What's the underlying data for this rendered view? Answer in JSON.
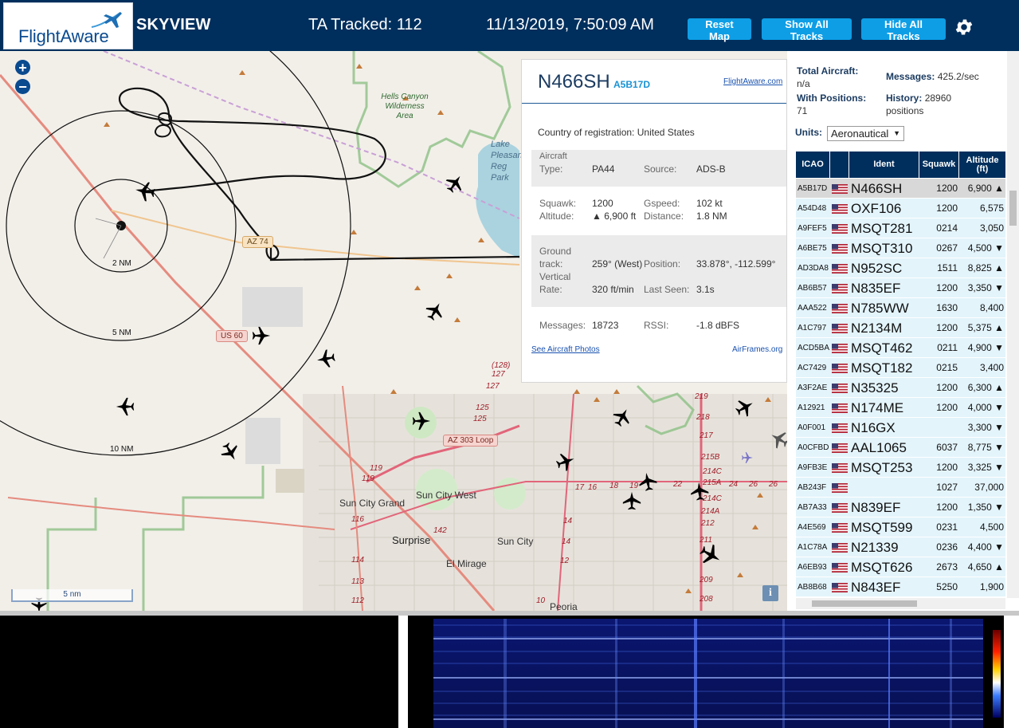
{
  "header": {
    "logo_text": "FlightAware",
    "app_name": "SKYVIEW",
    "ta_tracked": "TA Tracked: 112",
    "clock": "11/13/2019, 7:50:09 AM",
    "buttons": {
      "reset": "Reset Map",
      "show_all": "Show All Tracks",
      "hide_all": "Hide All Tracks"
    },
    "settings_icon": "gear-icon",
    "colors": {
      "bar": "#002f5d",
      "button": "#0e9ee6"
    }
  },
  "map": {
    "zoom_in": "+",
    "zoom_out": "−",
    "scale_label": "5 nm",
    "info_label": "i",
    "range_rings": [
      "2 NM",
      "5 NM",
      "10 NM"
    ],
    "places": [
      "Hells Canyon Wilderness Area",
      "Sun City Grand",
      "Sun City West",
      "Surprise",
      "Sun City",
      "El Mirage",
      "Peoria"
    ],
    "water": [
      "Lake Pleasant Reg Park"
    ],
    "shields": [
      "AZ 74",
      "US 60",
      "AZ 303 Loop"
    ],
    "road_numbers": [
      "(128)",
      "127",
      "127",
      "125",
      "125",
      "119",
      "119",
      "116",
      "114",
      "113",
      "112",
      "142",
      "14",
      "14",
      "12",
      "10",
      "17",
      "16",
      "18",
      "19",
      "22",
      "24",
      "26",
      "26",
      "219",
      "218",
      "217",
      "215B",
      "214C",
      "215A",
      "214C",
      "214A",
      "212",
      "211",
      "209",
      "208"
    ]
  },
  "selected": {
    "callsign": "N466SH",
    "icao": "A5B17D",
    "fa_link": "FlightAware.com",
    "country_label": "Country of registration:",
    "country": "United States",
    "aircraft_type_label": "Aircraft Type:",
    "aircraft_type_l1": "Aircraft",
    "aircraft_type_l2": "Type:",
    "aircraft_type": "PA44",
    "source_label": "Source:",
    "source": "ADS-B",
    "squawk_label": "Squawk:",
    "squawk": "1200",
    "gspeed_label": "Gspeed:",
    "gspeed": "102 kt",
    "altitude_label": "Altitude:",
    "altitude": "▲ 6,900 ft",
    "distance_label": "Distance:",
    "distance": "1.8 NM",
    "ground_track_l1": "Ground",
    "ground_track_l2": "track:",
    "ground_track": "259° (West)",
    "position_label": "Position:",
    "position": "33.878°, -112.599°",
    "vertical_l1": "Vertical",
    "vertical_l2": "Rate:",
    "vertical_rate": "320 ft/min",
    "last_seen_label": "Last Seen:",
    "last_seen": "3.1s",
    "messages_label": "Messages:",
    "messages": "18723",
    "rssi_label": "RSSI:",
    "rssi": "-1.8 dBFS",
    "photos_link": "See Aircraft Photos",
    "airframes_link": "AirFrames.org"
  },
  "sidebar": {
    "total_aircraft_label": "Total Aircraft:",
    "total_aircraft": "n/a",
    "with_positions_label": "With Positions:",
    "with_positions": "71",
    "messages_label": "Messages:",
    "messages_rate": "425.2/sec",
    "history_label": "History:",
    "history_value": "28960",
    "history_unit": "positions",
    "units_label": "Units:",
    "units_value": "Aeronautical",
    "table": {
      "headers": {
        "icao": "ICAO",
        "ident": "Ident",
        "squawk": "Squawk",
        "altitude_l1": "Altitude",
        "altitude_l2": "(ft)"
      },
      "rows": [
        {
          "icao": "A5B17D",
          "ident": "N466SH",
          "squawk": "1200",
          "alt": "6,900 ▲"
        },
        {
          "icao": "A54D48",
          "ident": "OXF106",
          "squawk": "1200",
          "alt": "6,575"
        },
        {
          "icao": "A9FEF5",
          "ident": "MSQT281",
          "squawk": "0214",
          "alt": "3,050"
        },
        {
          "icao": "A6BE75",
          "ident": "MSQT310",
          "squawk": "0267",
          "alt": "4,500 ▼"
        },
        {
          "icao": "AD3DA8",
          "ident": "N952SC",
          "squawk": "1511",
          "alt": "8,825 ▲"
        },
        {
          "icao": "AB6B57",
          "ident": "N835EF",
          "squawk": "1200",
          "alt": "3,350 ▼"
        },
        {
          "icao": "AAA522",
          "ident": "N785WW",
          "squawk": "1630",
          "alt": "8,400"
        },
        {
          "icao": "A1C797",
          "ident": "N2134M",
          "squawk": "1200",
          "alt": "5,375 ▲"
        },
        {
          "icao": "ACD5BA",
          "ident": "MSQT462",
          "squawk": "0211",
          "alt": "4,900 ▼"
        },
        {
          "icao": "AC7429",
          "ident": "MSQT182",
          "squawk": "0215",
          "alt": "3,400"
        },
        {
          "icao": "A3F2AE",
          "ident": "N35325",
          "squawk": "1200",
          "alt": "6,300 ▲"
        },
        {
          "icao": "A12921",
          "ident": "N174ME",
          "squawk": "1200",
          "alt": "4,000 ▼"
        },
        {
          "icao": "A0F001",
          "ident": "N16GX",
          "squawk": "",
          "alt": "3,300 ▼"
        },
        {
          "icao": "A0CFBD",
          "ident": "AAL1065",
          "squawk": "6037",
          "alt": "8,775 ▼"
        },
        {
          "icao": "A9FB3E",
          "ident": "MSQT253",
          "squawk": "1200",
          "alt": "3,325 ▼"
        },
        {
          "icao": "AB243F",
          "ident": "",
          "squawk": "1027",
          "alt": "37,000"
        },
        {
          "icao": "AB7A33",
          "ident": "N839EF",
          "squawk": "1200",
          "alt": "1,350 ▼"
        },
        {
          "icao": "A4E569",
          "ident": "MSQT599",
          "squawk": "0231",
          "alt": "4,500"
        },
        {
          "icao": "A1C78A",
          "ident": "N21339",
          "squawk": "0236",
          "alt": "4,400 ▼"
        },
        {
          "icao": "A6EB93",
          "ident": "MSQT626",
          "squawk": "2673",
          "alt": "4,650 ▲"
        },
        {
          "icao": "AB8B68",
          "ident": "N843EF",
          "squawk": "5250",
          "alt": "1,900"
        }
      ]
    }
  }
}
